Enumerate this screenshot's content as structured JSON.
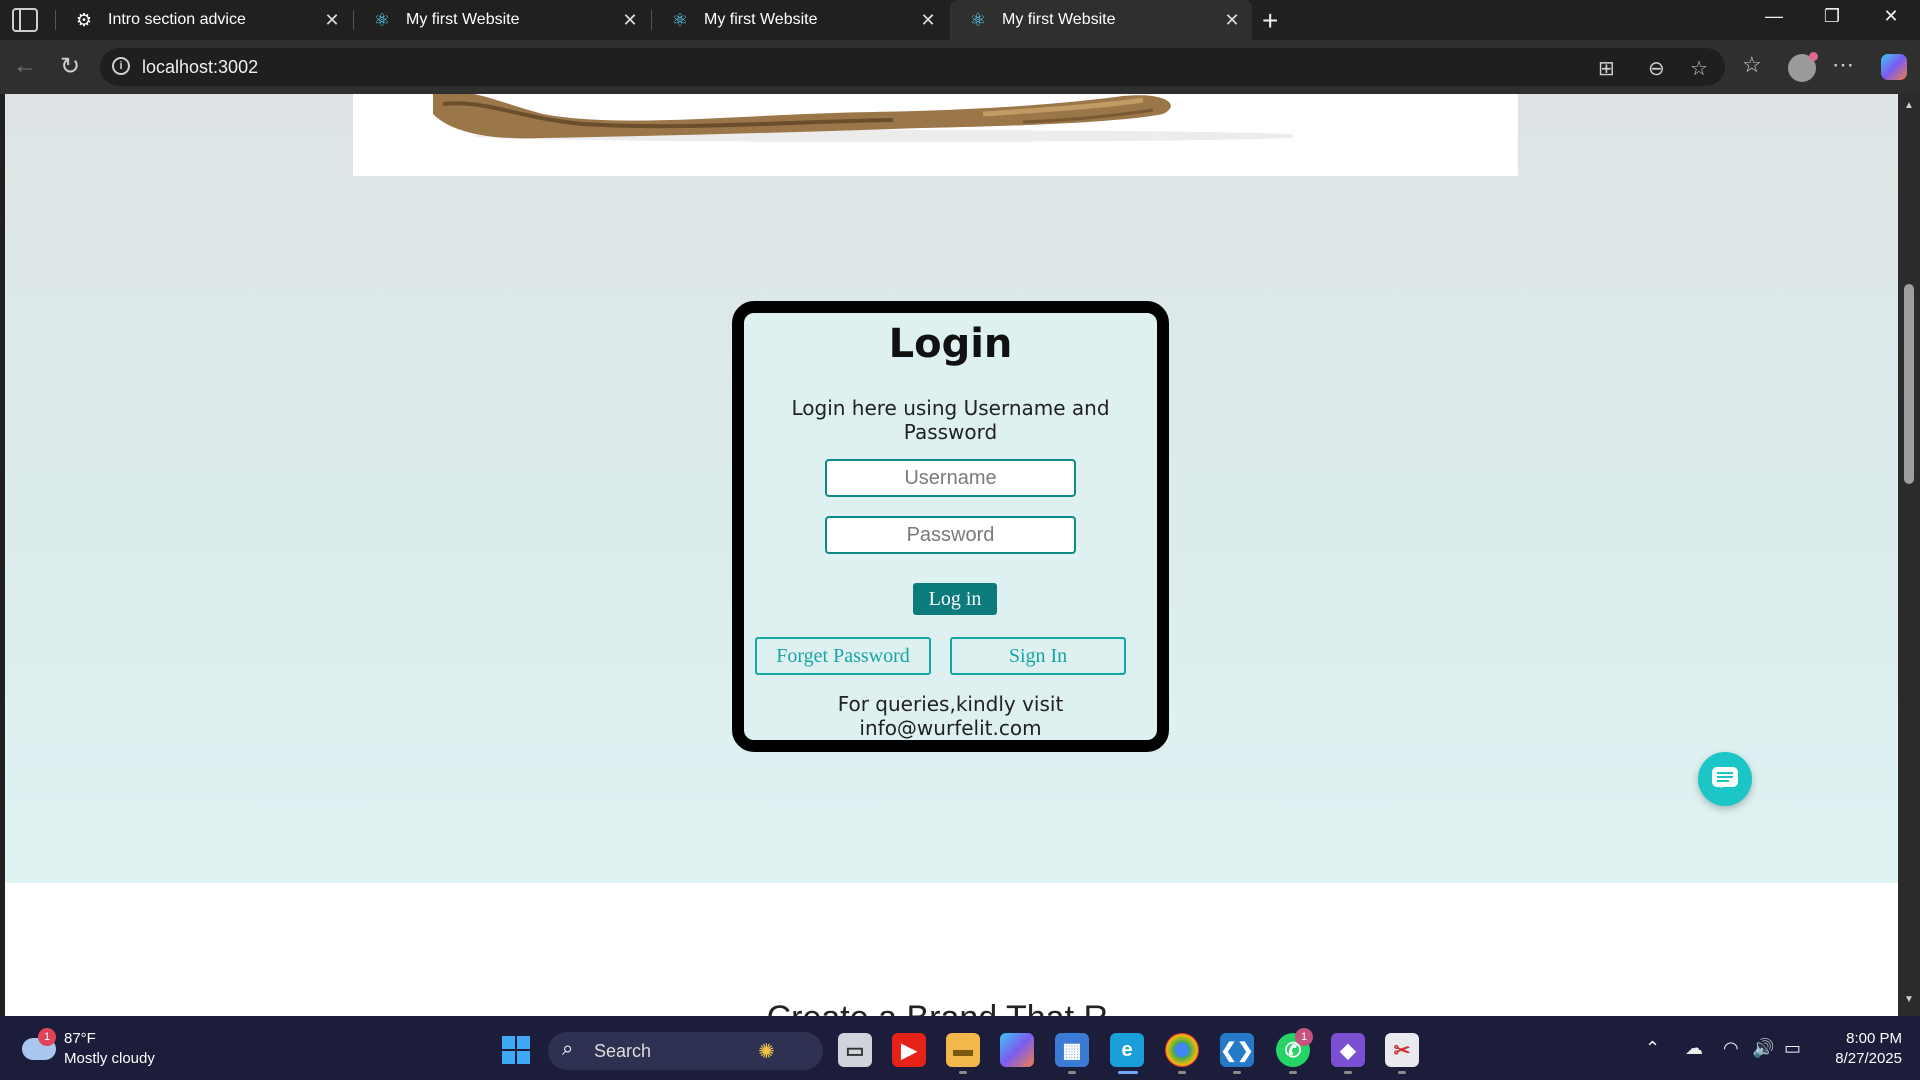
{
  "browser": {
    "tabs": [
      {
        "title": "Intro section advice",
        "icon": "chatgpt-icon"
      },
      {
        "title": "My first Website",
        "icon": "react-icon"
      },
      {
        "title": "My first Website",
        "icon": "react-icon"
      },
      {
        "title": "My first Website",
        "icon": "react-icon",
        "active": true
      }
    ],
    "url": "localhost:3002"
  },
  "login": {
    "title": "Login",
    "subtitle": "Login here using Username and Password",
    "username_placeholder": "Username",
    "password_placeholder": "Password",
    "login_button": "Log in",
    "forget_button": "Forget Password",
    "signin_button": "Sign In",
    "footer": "For queries,kindly visit info@wurfelit.com"
  },
  "page": {
    "next_heading": "Create a Brand That R..."
  },
  "taskbar": {
    "weather_badge": "1",
    "weather_temp": "87°F",
    "weather_condition": "Mostly cloudy",
    "search_label": "Search",
    "whatsapp_badge": "1",
    "time": "8:00 PM",
    "date": "8/27/2025"
  },
  "colors": {
    "accent": "#0b7b7b",
    "outline": "#17a6a6",
    "chat_button": "#1cc6c6"
  }
}
